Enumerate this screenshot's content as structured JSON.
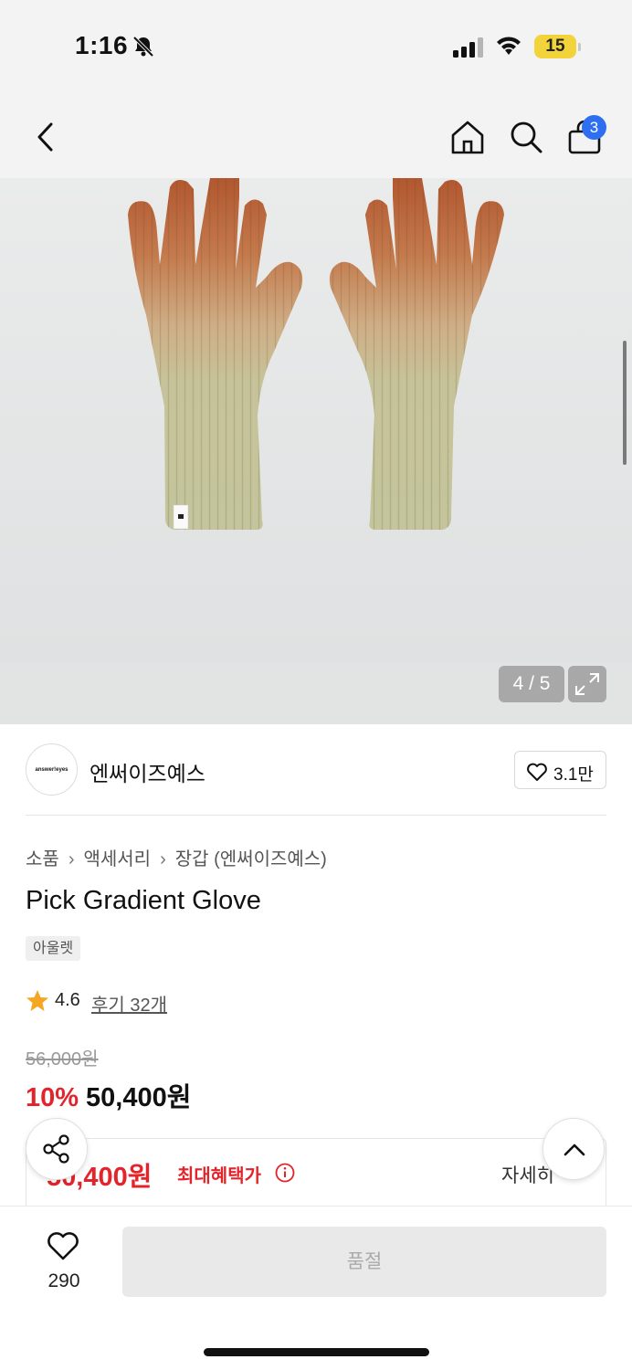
{
  "status_bar": {
    "time": "1:16",
    "battery": "15"
  },
  "header": {
    "cart_count": "3",
    "icons": [
      "back-icon",
      "home-icon",
      "search-icon",
      "bag-icon"
    ]
  },
  "gallery": {
    "pager": "4 / 5",
    "image_index": 4,
    "image_total": 5
  },
  "brand": {
    "logo_text": "answer!eyes",
    "name": "엔써이즈예스",
    "likes": "3.1만"
  },
  "breadcrumb": [
    "소품",
    "액세서리",
    "장갑 (엔써이즈예스)"
  ],
  "product": {
    "title": "Pick Gradient Glove",
    "tag": "아울렛",
    "rating": "4.6",
    "reviews": "후기 32개",
    "original_price": "56,000원",
    "discount": "10%",
    "sale_price": "50,400원",
    "benefit_price": "50,400원",
    "benefit_label": "최대혜택가",
    "detail_link": "자세히"
  },
  "bottom_bar": {
    "wish_count": "290",
    "buy_button": "품절"
  },
  "colors": {
    "accent_red": "#e3242b",
    "badge_blue": "#2d6ff0",
    "star": "#f5a623"
  }
}
